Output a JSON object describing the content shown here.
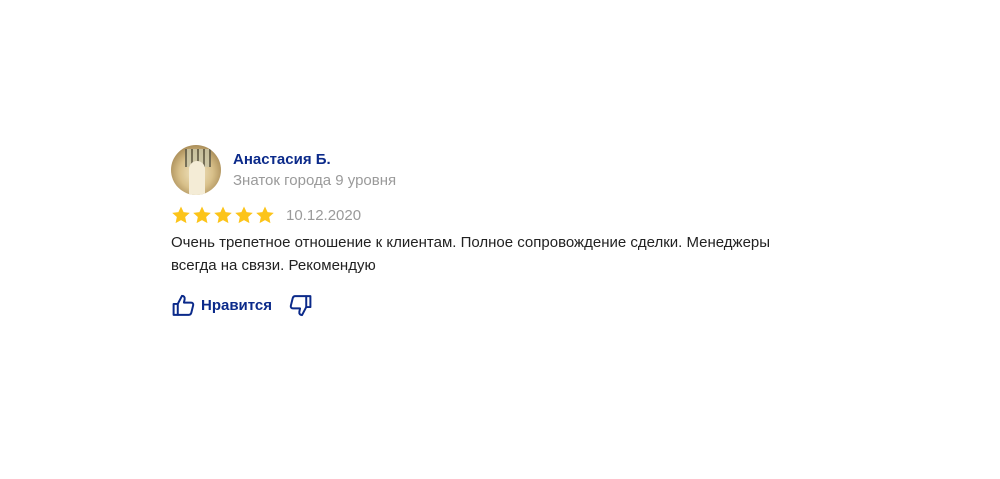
{
  "review": {
    "author": {
      "name": "Анастасия Б.",
      "level": "Знаток города 9 уровня",
      "avatar_icon": "user-photo"
    },
    "rating": 5,
    "rating_max": 5,
    "date": "10.12.2020",
    "text": "Очень трепетное отношение к клиентам. Полное сопровождение сделки. Менеджеры всегда на связи. Рекомендую",
    "actions": {
      "like_label": "Нравится",
      "like_icon": "thumbs-up-icon",
      "dislike_icon": "thumbs-down-icon"
    }
  },
  "colors": {
    "link": "#0b2a8a",
    "star": "#fcc419",
    "muted": "#9a9a9a",
    "text": "#222222"
  }
}
